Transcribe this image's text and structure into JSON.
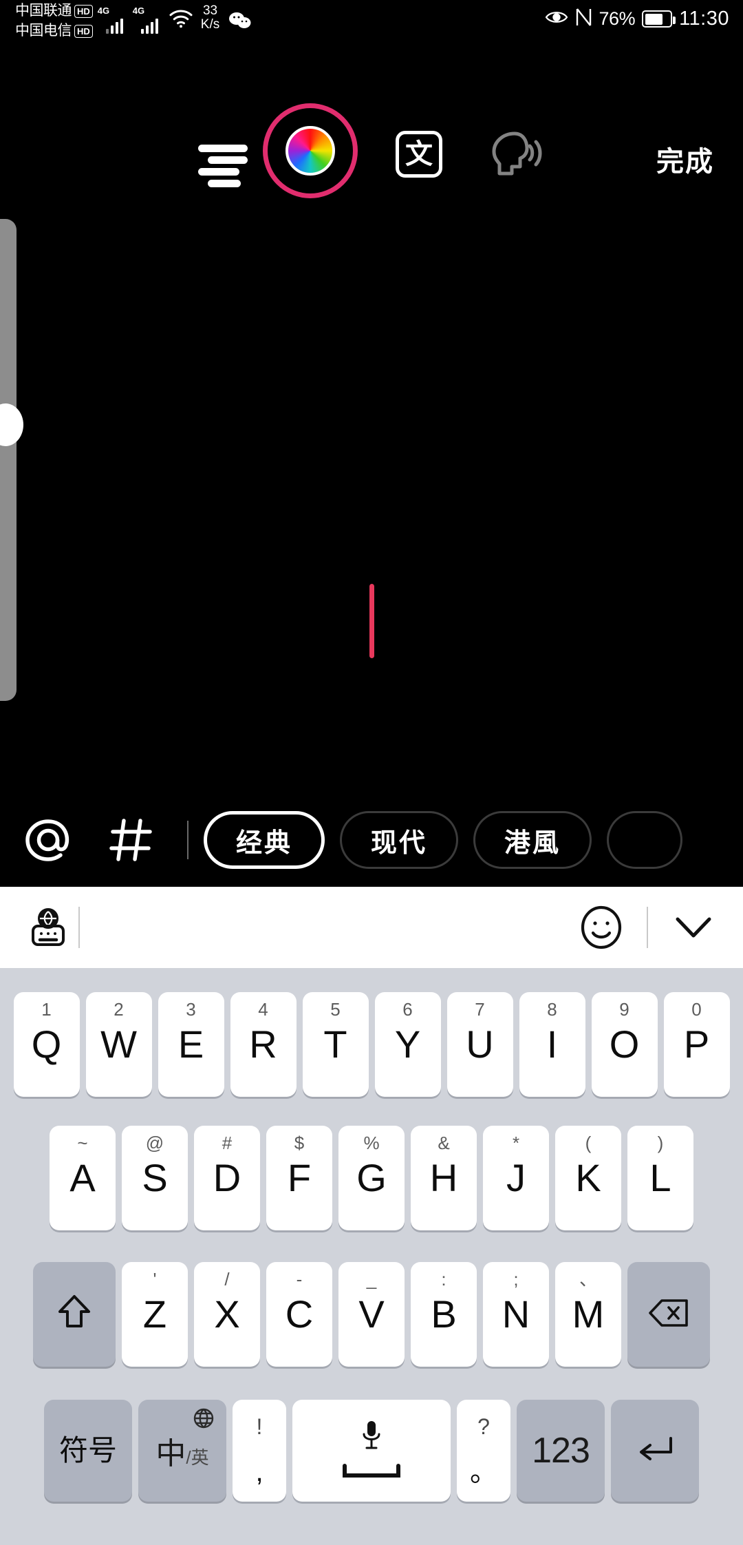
{
  "status_bar": {
    "carrier1": "中国联通",
    "carrier1_badge": "HD",
    "carrier2": "中国电信",
    "carrier2_badge": "HD",
    "network1": "4G",
    "network2": "4G",
    "net_speed_value": "33",
    "net_speed_unit": "K/s",
    "wifi_icon": "wifi-icon",
    "wechat_icon": "wechat-icon",
    "eye_comfort_icon": "eye-icon",
    "nfc_icon": "nfc-icon",
    "battery_percent": "76%",
    "battery_icon": "battery-icon",
    "clock": "11:30"
  },
  "toolbar": {
    "align_icon": "text-align-icon",
    "color_icon": "color-wheel-icon",
    "color_ring_hex": "#e12d6e",
    "font_icon_label": "文",
    "tts_icon": "text-to-speech-icon",
    "done_label": "完成"
  },
  "editor": {
    "size_slider_name": "font-size-slider",
    "cursor_color": "#e8385c"
  },
  "style_bar": {
    "mention_icon": "at-icon",
    "hashtag_icon": "hashtag-icon",
    "chips": [
      {
        "label": "经典",
        "selected": true
      },
      {
        "label": "现代",
        "selected": false
      },
      {
        "label": "港風",
        "selected": false
      },
      {
        "label": "",
        "selected": false
      }
    ]
  },
  "keyboard": {
    "toolbar": {
      "input_method_icon": "globe-keyboard-icon",
      "emoji_icon": "emoji-smiley-icon",
      "collapse_icon": "chevron-down-icon"
    },
    "row1": [
      {
        "sup": "1",
        "main": "Q"
      },
      {
        "sup": "2",
        "main": "W"
      },
      {
        "sup": "3",
        "main": "E"
      },
      {
        "sup": "4",
        "main": "R"
      },
      {
        "sup": "5",
        "main": "T"
      },
      {
        "sup": "6",
        "main": "Y"
      },
      {
        "sup": "7",
        "main": "U"
      },
      {
        "sup": "8",
        "main": "I"
      },
      {
        "sup": "9",
        "main": "O"
      },
      {
        "sup": "0",
        "main": "P"
      }
    ],
    "row2": [
      {
        "sup": "~",
        "main": "A"
      },
      {
        "sup": "@",
        "main": "S"
      },
      {
        "sup": "#",
        "main": "D"
      },
      {
        "sup": "$",
        "main": "F"
      },
      {
        "sup": "%",
        "main": "G"
      },
      {
        "sup": "&",
        "main": "H"
      },
      {
        "sup": "*",
        "main": "J"
      },
      {
        "sup": "(",
        "main": "K"
      },
      {
        "sup": ")",
        "main": "L"
      }
    ],
    "row3": {
      "shift_icon": "shift-arrow-icon",
      "keys": [
        {
          "sup": "'",
          "main": "Z"
        },
        {
          "sup": "/",
          "main": "X"
        },
        {
          "sup": "-",
          "main": "C"
        },
        {
          "sup": "_",
          "main": "V"
        },
        {
          "sup": ":",
          "main": "B"
        },
        {
          "sup": ";",
          "main": "N"
        },
        {
          "sup": "、",
          "main": "M"
        }
      ],
      "backspace_icon": "backspace-icon"
    },
    "row4": {
      "symbols_label": "符号",
      "lang_main": "中",
      "lang_sub": "/英",
      "lang_globe_icon": "globe-icon",
      "comma_top": "!",
      "comma_bottom": ",",
      "space_mic_icon": "microphone-icon",
      "space_bar_icon": "space-bar-icon",
      "period_top": "?",
      "period_bottom": "。",
      "numbers_label": "123",
      "enter_icon": "enter-icon"
    }
  }
}
